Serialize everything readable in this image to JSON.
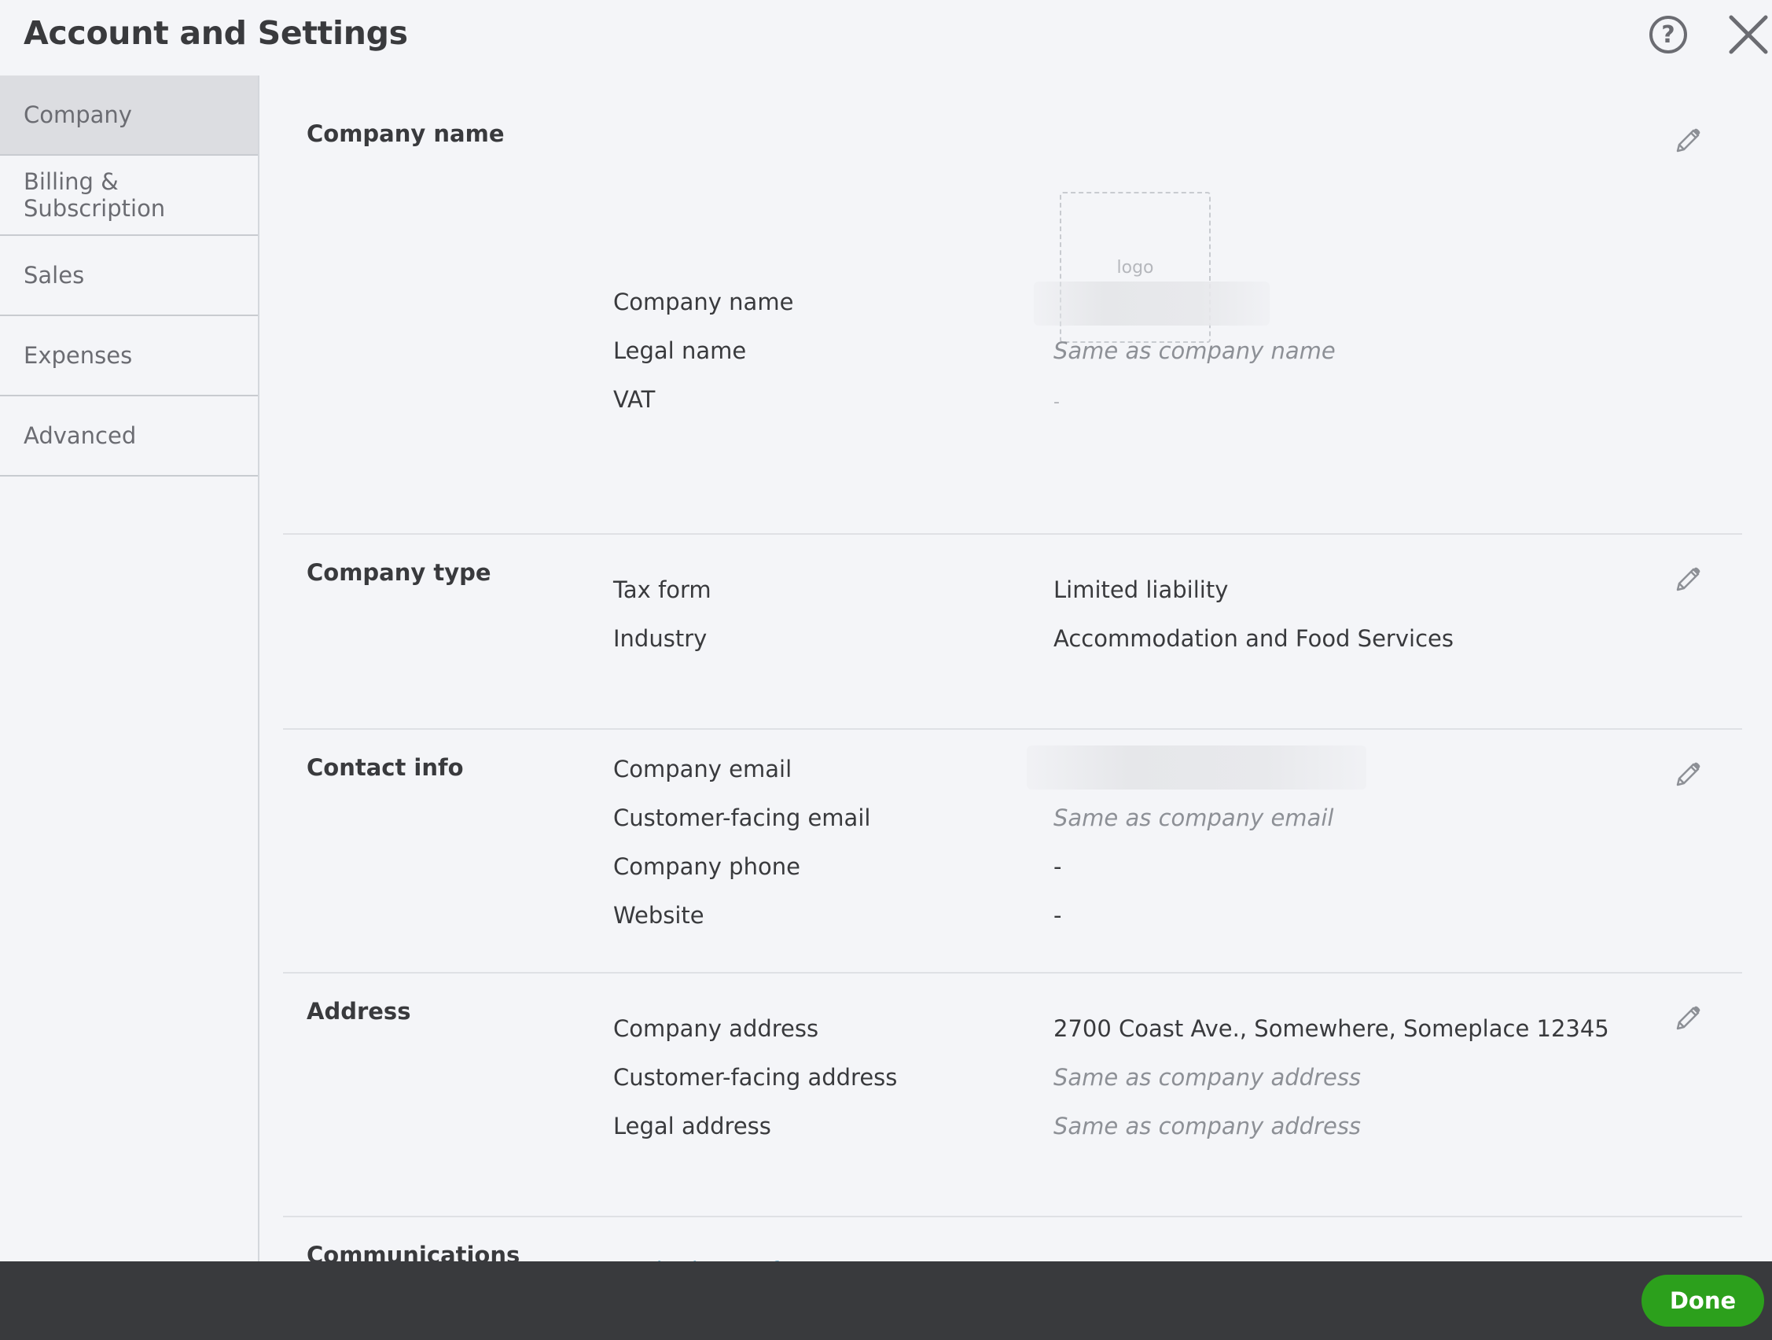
{
  "header": {
    "title": "Account and Settings",
    "help_icon_glyph": "?",
    "help_icon": "question-circle-icon",
    "close_icon": "close-icon"
  },
  "sidebar": {
    "items": [
      {
        "label": "Company",
        "active": true
      },
      {
        "label": "Billing & Subscription",
        "active": false
      },
      {
        "label": "Sales",
        "active": false
      },
      {
        "label": "Expenses",
        "active": false
      },
      {
        "label": "Advanced",
        "active": false
      }
    ]
  },
  "sections": {
    "company_name": {
      "title": "Company name",
      "logo_text": "logo",
      "rows": [
        {
          "label": "Company name",
          "value": ""
        },
        {
          "label": "Legal name",
          "value": "Same as company name"
        },
        {
          "label": "VAT",
          "value": "-"
        }
      ]
    },
    "company_type": {
      "title": "Company type",
      "rows": [
        {
          "label": "Tax form",
          "value": "Limited liability"
        },
        {
          "label": "Industry",
          "value": "Accommodation and Food Services"
        }
      ]
    },
    "contact_info": {
      "title": "Contact info",
      "rows": [
        {
          "label": "Company email",
          "value": ""
        },
        {
          "label": "Customer-facing email",
          "value": "Same as company email"
        },
        {
          "label": "Company phone",
          "value": "-"
        },
        {
          "label": "Website",
          "value": "-"
        }
      ]
    },
    "address": {
      "title": "Address",
      "rows": [
        {
          "label": "Company address",
          "value": "2700 Coast Ave., Somewhere, Someplace 12345"
        },
        {
          "label": "Customer-facing address",
          "value": "Same as company address"
        },
        {
          "label": "Legal address",
          "value": "Same as company address"
        }
      ]
    },
    "communications": {
      "title": "Communications with Intuit",
      "link": "Marketing Preferences"
    }
  },
  "footer": {
    "done_label": "Done"
  },
  "colors": {
    "accent_green": "#2ca01c",
    "link_blue": "#0d7ba7",
    "footer_bg": "#393a3d",
    "page_bg": "#f4f5f8"
  }
}
